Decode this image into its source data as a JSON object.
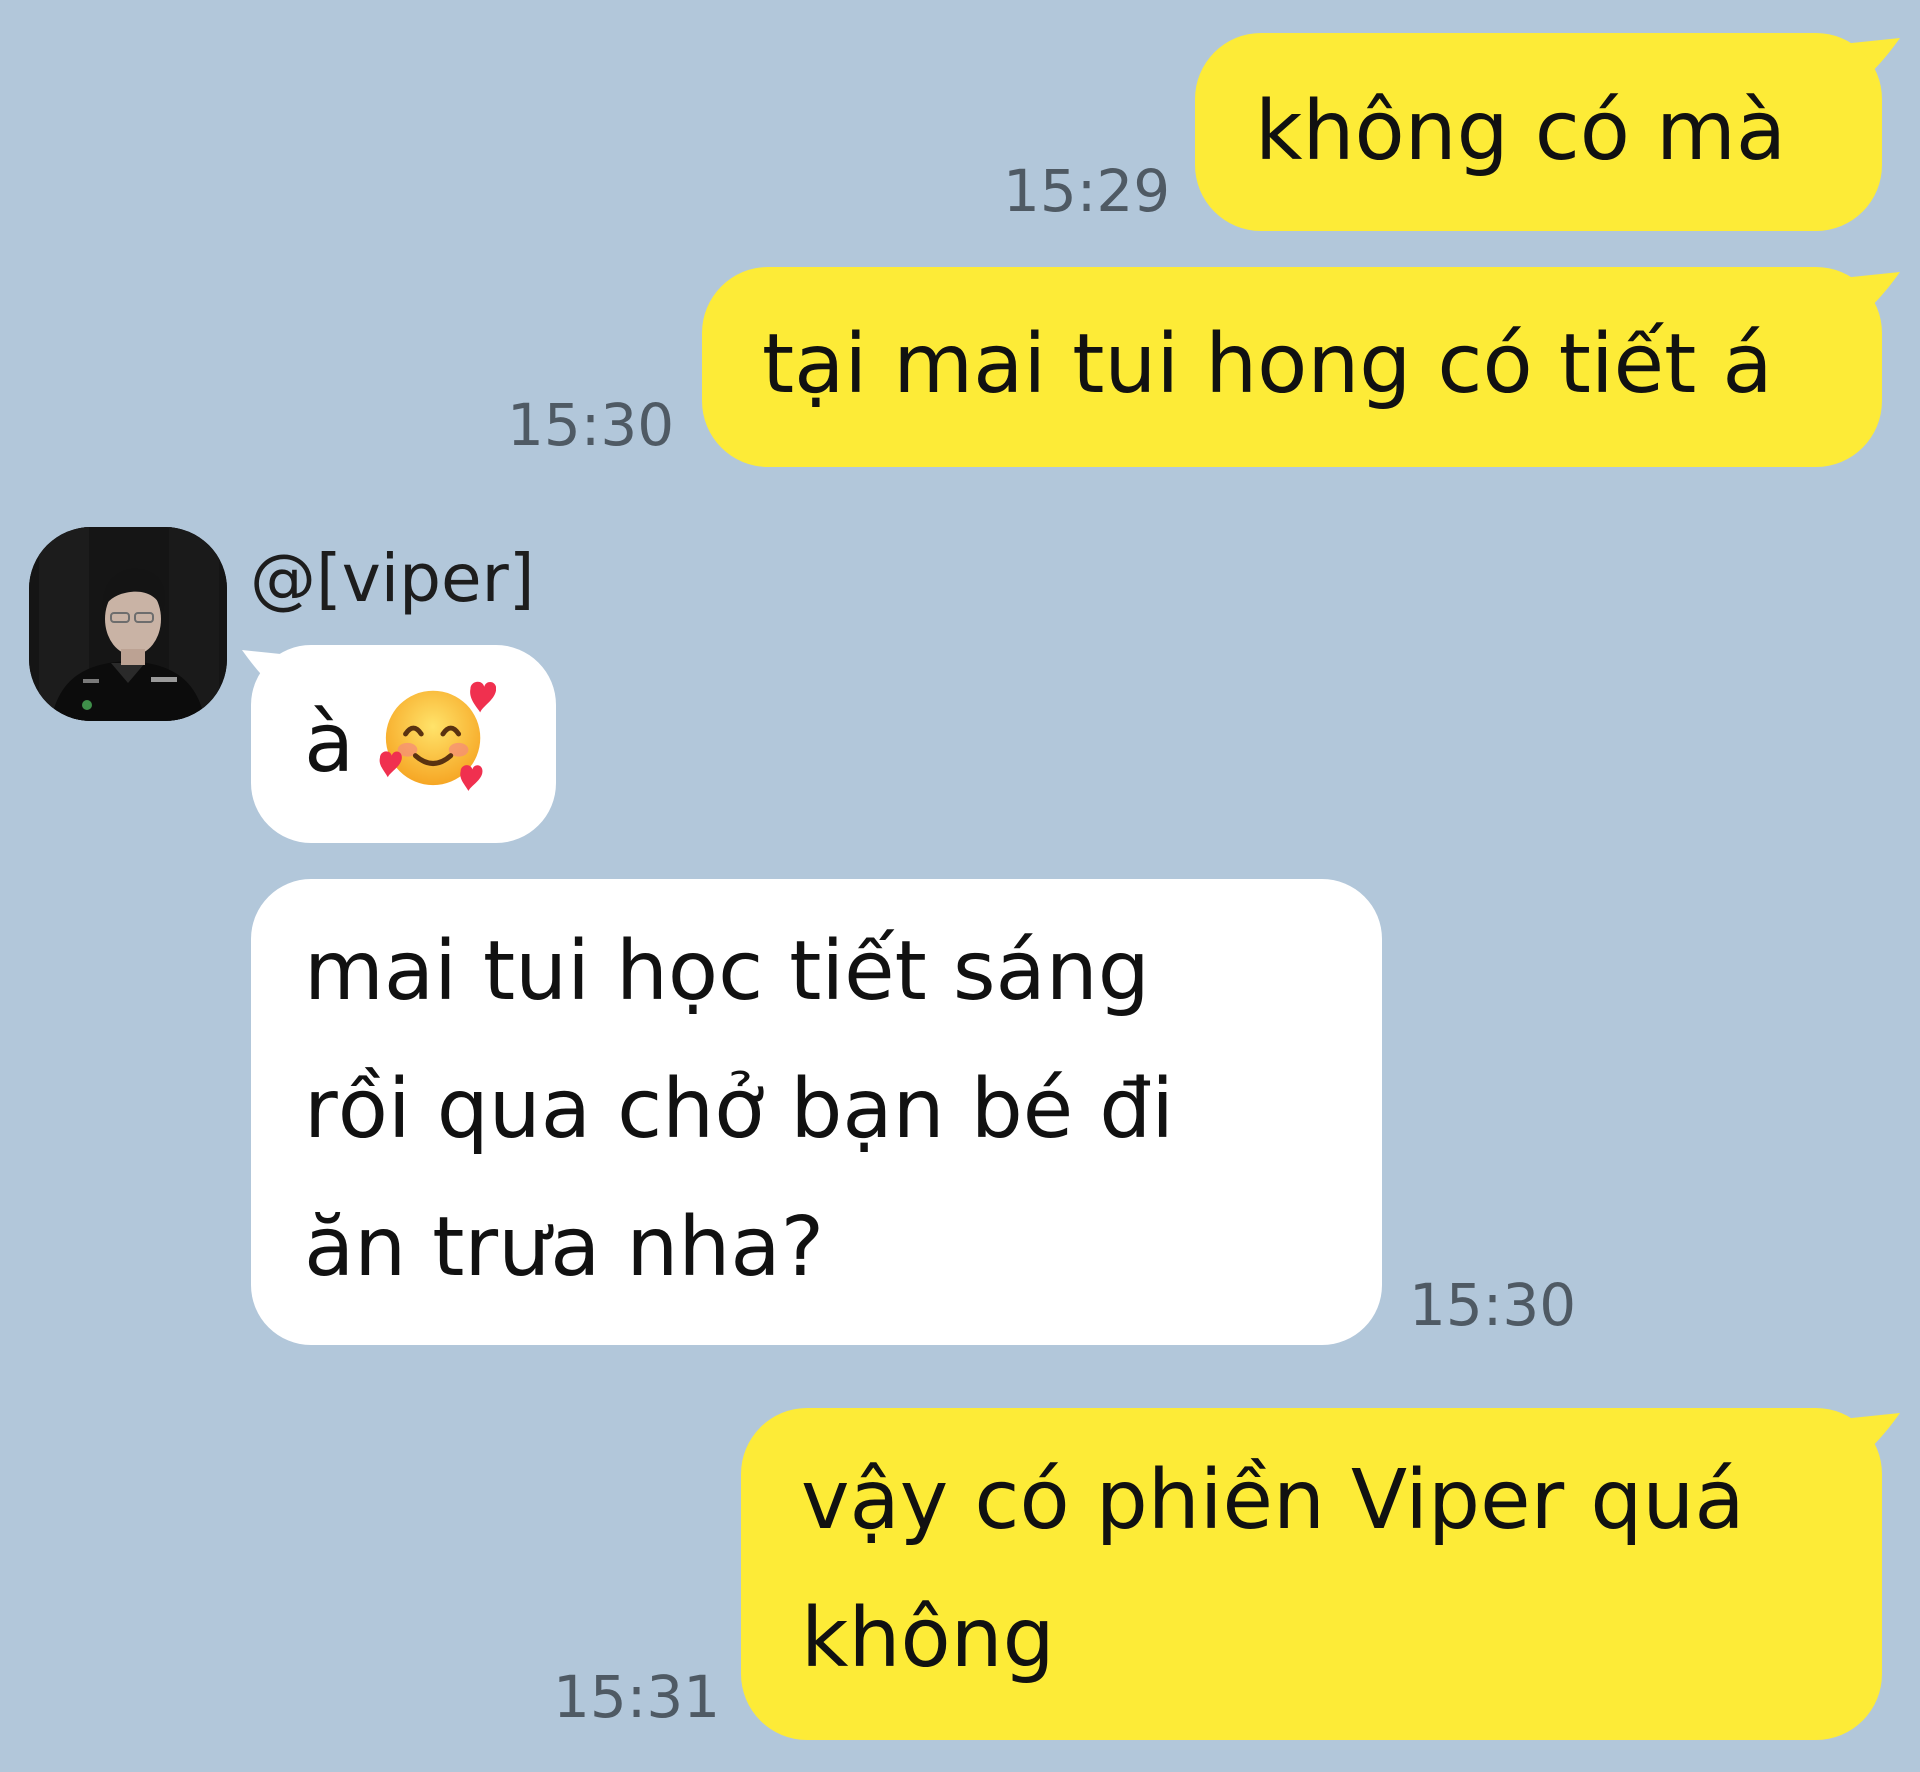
{
  "chat": {
    "messages": [
      {
        "side": "outgoing",
        "text": "không có mà",
        "time": "15:29"
      },
      {
        "side": "outgoing",
        "text": "tại mai tui hong có tiết á",
        "time": "15:30"
      },
      {
        "side": "incoming",
        "sender": "@[viper]",
        "text": "à",
        "emoji": "smiling-face-with-hearts-icon"
      },
      {
        "side": "incoming",
        "lines": [
          "mai tui học tiết sáng",
          "rồi qua chở bạn bé đi",
          "ăn trưa nha?"
        ],
        "time": "15:30"
      },
      {
        "side": "outgoing",
        "lines": [
          "vậy có phiền Viper quá",
          "không"
        ],
        "time": "15:31"
      }
    ]
  },
  "colors": {
    "background": "#b2c7da",
    "outgoing_bubble": "#fdeb37",
    "incoming_bubble": "#ffffff",
    "timestamp": "#4f5a64"
  }
}
